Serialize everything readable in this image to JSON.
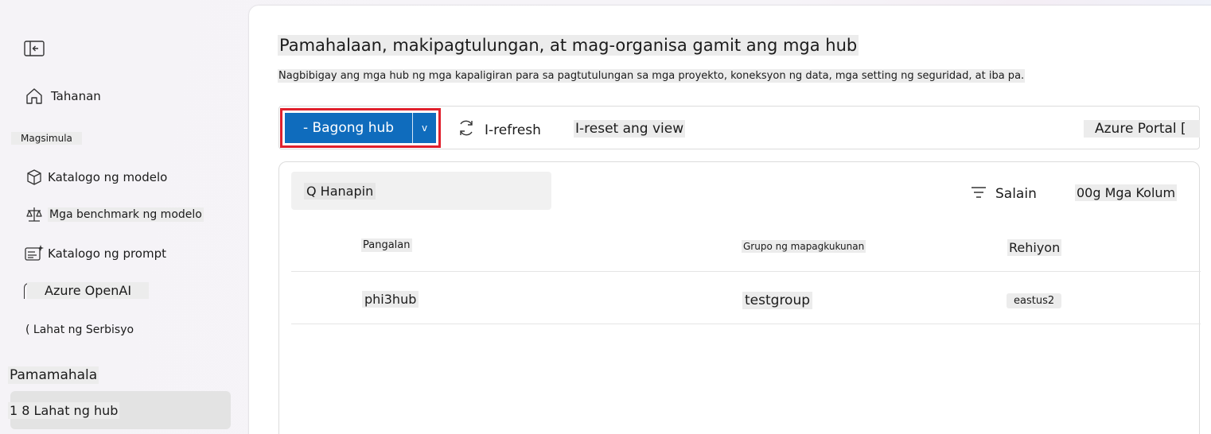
{
  "sidebar": {
    "collapse_icon": "panel-collapse-icon",
    "items": [
      {
        "label": "Tahanan",
        "icon": "home-icon"
      },
      {
        "label": "Katalogo ng modelo",
        "icon": "cube-icon"
      },
      {
        "label": "Mga benchmark ng modelo",
        "icon": "scale-icon"
      },
      {
        "label": "Katalogo ng prompt",
        "icon": "prompt-icon"
      },
      {
        "label": "Azure OpenAI",
        "icon": "openai-icon"
      },
      {
        "label": "( Lahat ng Serbisyo",
        "icon": ""
      },
      {
        "label": "1 8 Lahat ng hub",
        "icon": ""
      }
    ],
    "sections": {
      "simulate": "Magsimula",
      "manage": "Pamamahala"
    }
  },
  "main": {
    "title": "Pamahalaan, makipagtulungan, at mag-organisa gamit ang mga hub",
    "subtitle": "Nagbibigay ang mga hub ng mga kapaligiran para sa pagtutulungan sa mga proyekto, koneksyon ng data, mga setting ng seguridad, at iba pa."
  },
  "toolbar": {
    "new_hub_label": "- Bagong hub",
    "caret_label": "v",
    "refresh_label": "I-refresh",
    "reset_label": "I-reset ang view",
    "portal_label": "Azure Portal ["
  },
  "table": {
    "search_placeholder": "Q Hanapin",
    "filter_label": "Salain",
    "columns_label": "00g Mga Kolum",
    "headers": [
      "Pangalan",
      "Grupo ng mapagkukunan",
      "Rehiyon"
    ],
    "rows": [
      {
        "name": "phi3hub",
        "group": "testgroup",
        "region": "eastus2"
      }
    ]
  },
  "colors": {
    "accent": "#0f6cbd",
    "highlight_border": "#e0202c"
  }
}
